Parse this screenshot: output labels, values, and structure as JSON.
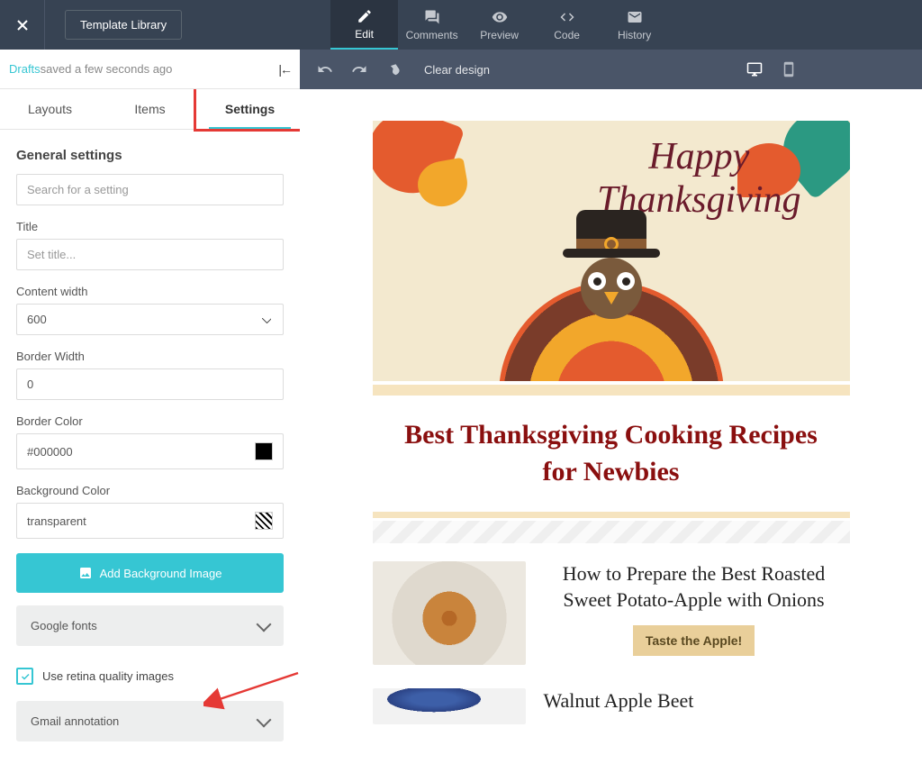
{
  "topbar": {
    "template_library": "Template Library",
    "tabs": [
      {
        "label": "Edit",
        "active": true
      },
      {
        "label": "Comments"
      },
      {
        "label": "Preview"
      },
      {
        "label": "Code"
      },
      {
        "label": "History"
      }
    ]
  },
  "status": {
    "drafts": "Drafts",
    "saved": " saved a few seconds ago"
  },
  "actionbar": {
    "clear_design": "Clear design"
  },
  "panel": {
    "tabs": [
      "Layouts",
      "Items",
      "Settings"
    ],
    "active_tab": "Settings",
    "section_title": "General settings",
    "search_placeholder": "Search for a setting",
    "title_label": "Title",
    "title_placeholder": "Set title...",
    "content_width_label": "Content width",
    "content_width_value": "600",
    "border_width_label": "Border Width",
    "border_width_value": "0",
    "border_color_label": "Border Color",
    "border_color_value": "#000000",
    "bg_color_label": "Background Color",
    "bg_color_value": "transparent",
    "add_bg_image": "Add Background Image",
    "google_fonts": "Google fonts",
    "retina_label": "Use retina quality images",
    "gmail_annotation": "Gmail annotation"
  },
  "preview": {
    "hero_line1": "Happy",
    "hero_line2": "Thanksgiving",
    "headline": "Best Thanksgiving Cooking Recipes for Newbies",
    "article1_title": "How to Prepare the Best Roasted Sweet Potato-Apple with Onions",
    "article1_cta": "Taste the Apple!",
    "article2_title": "Walnut Apple Beet"
  }
}
